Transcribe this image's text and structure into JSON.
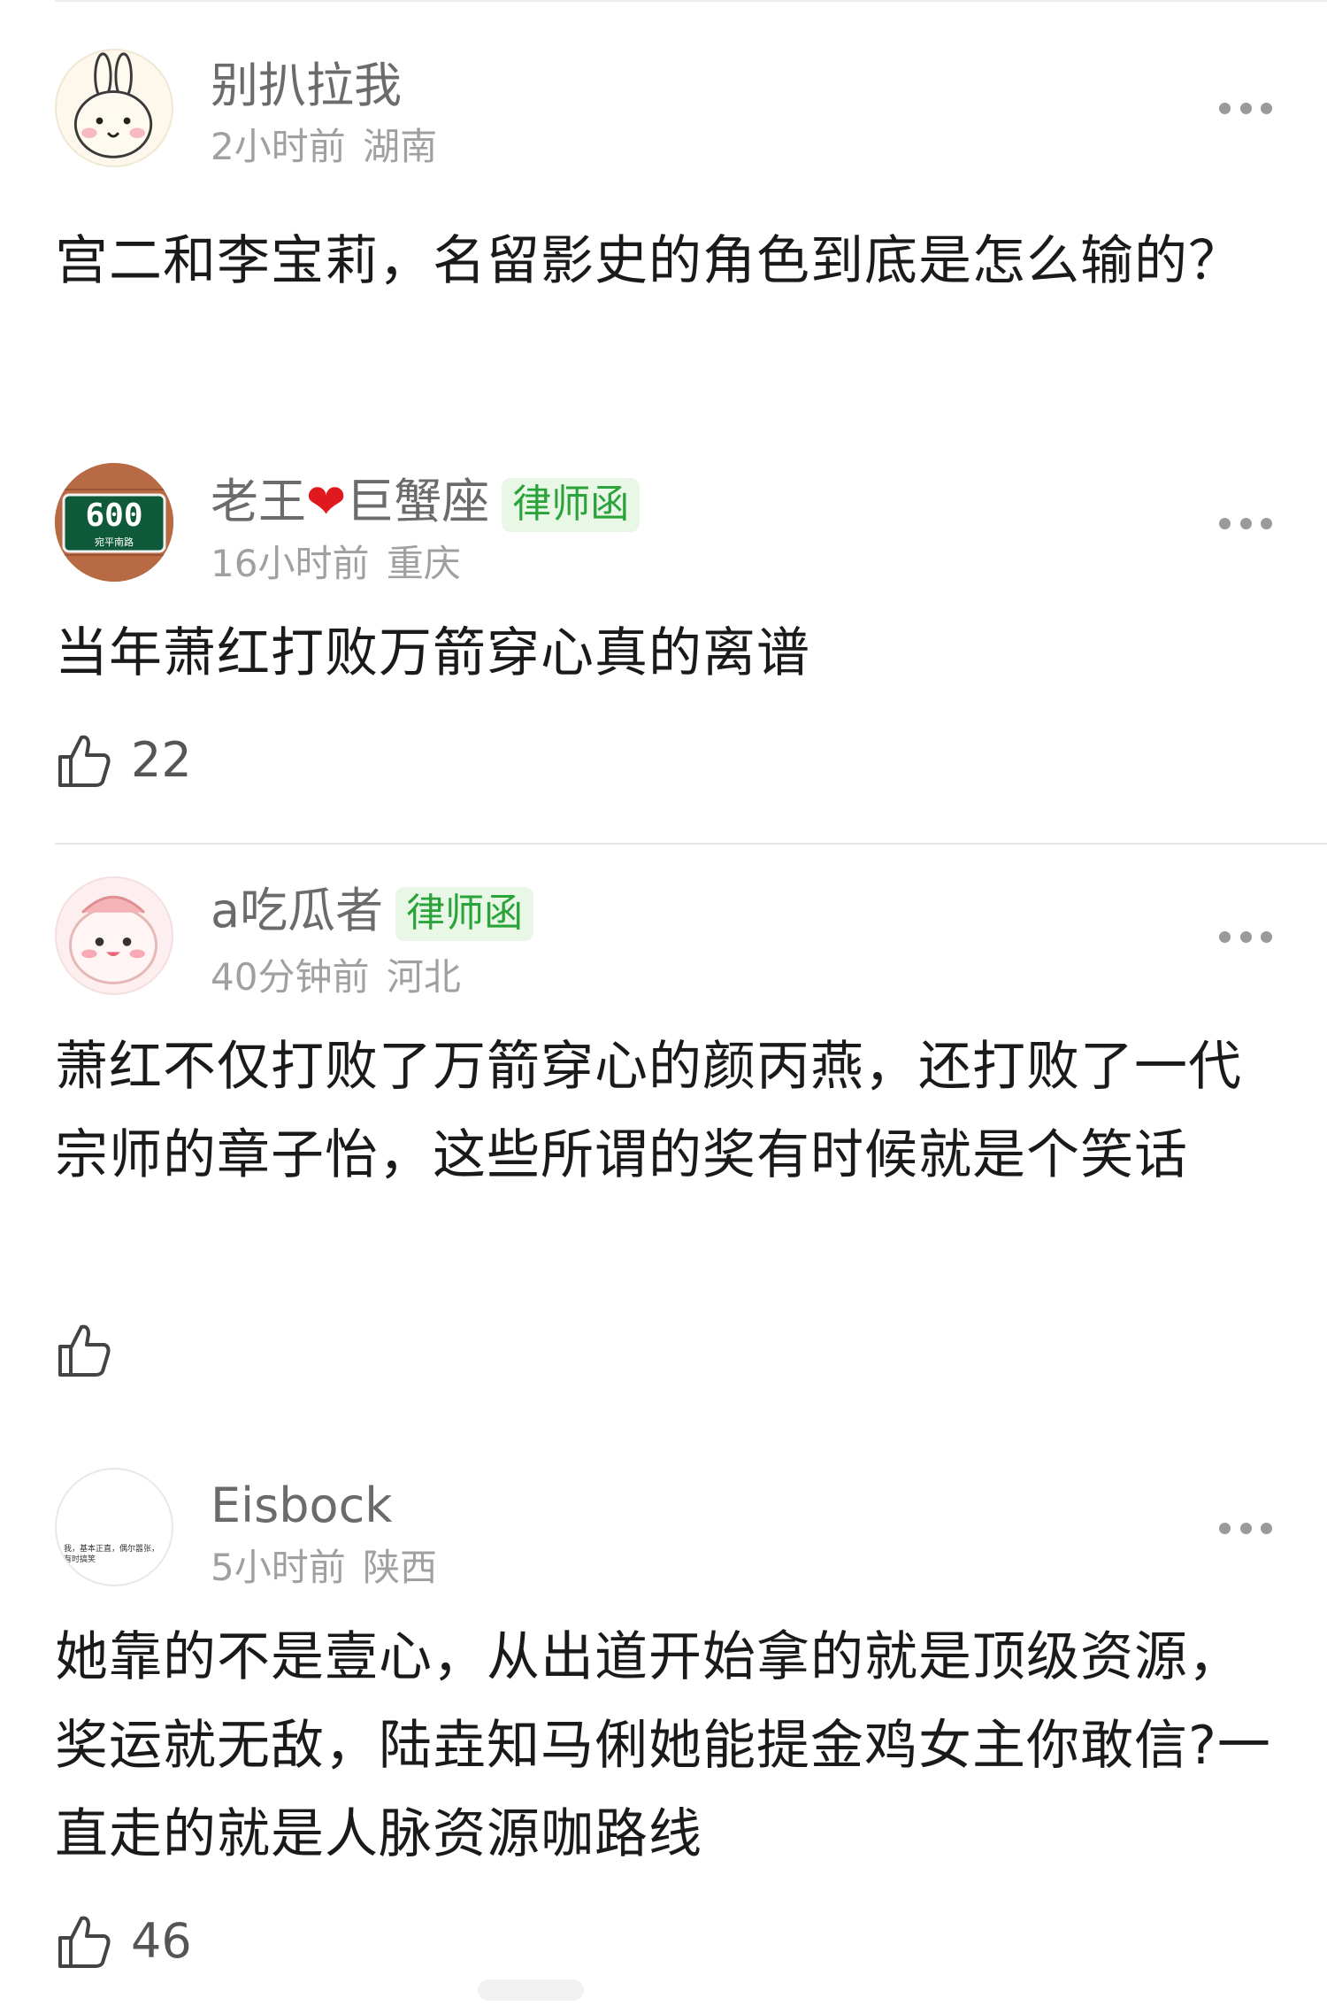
{
  "comments": [
    {
      "username": "别扒拉我",
      "time": "2小时前",
      "location": "湖南",
      "text": "宫二和李宝莉，名留影史的角色到底是怎么输的？"
    },
    {
      "username_part1": "老王",
      "heart": "❤",
      "username_part2": "巨蟹座",
      "badge": "律师函",
      "avatar_sign_number": "600",
      "avatar_sign_sub": "宛平南路",
      "time": "16小时前",
      "location": "重庆",
      "text": "当年萧红打败万箭穿心真的离谱",
      "likes": "22"
    },
    {
      "username": "a吃瓜者",
      "badge": "律师函",
      "time": "40分钟前",
      "location": "河北",
      "text": "萧红不仅打败了万箭穿心的颜丙燕，还打败了一代宗师的章子怡，这些所谓的奖有时候就是个笑话"
    },
    {
      "username": "Eisbock",
      "avatar_text": "我，基本正直，偶尔嚣张，有时搞笑",
      "time": "5小时前",
      "location": "陕西",
      "text": "她靠的不是壹心，从出道开始拿的就是顶级资源，奖运就无敌，陆垚知马俐她能提金鸡女主你敢信?一直走的就是人脉资源咖路线",
      "likes": "46"
    }
  ],
  "icons": {
    "more": "more-dots-icon",
    "like": "thumbs-up-icon"
  },
  "colors": {
    "badge_bg": "#e9f7e6",
    "badge_text": "#2aa33a",
    "heart": "#e0191f",
    "username": "#6b6b6b",
    "meta": "#a0a0a0"
  }
}
